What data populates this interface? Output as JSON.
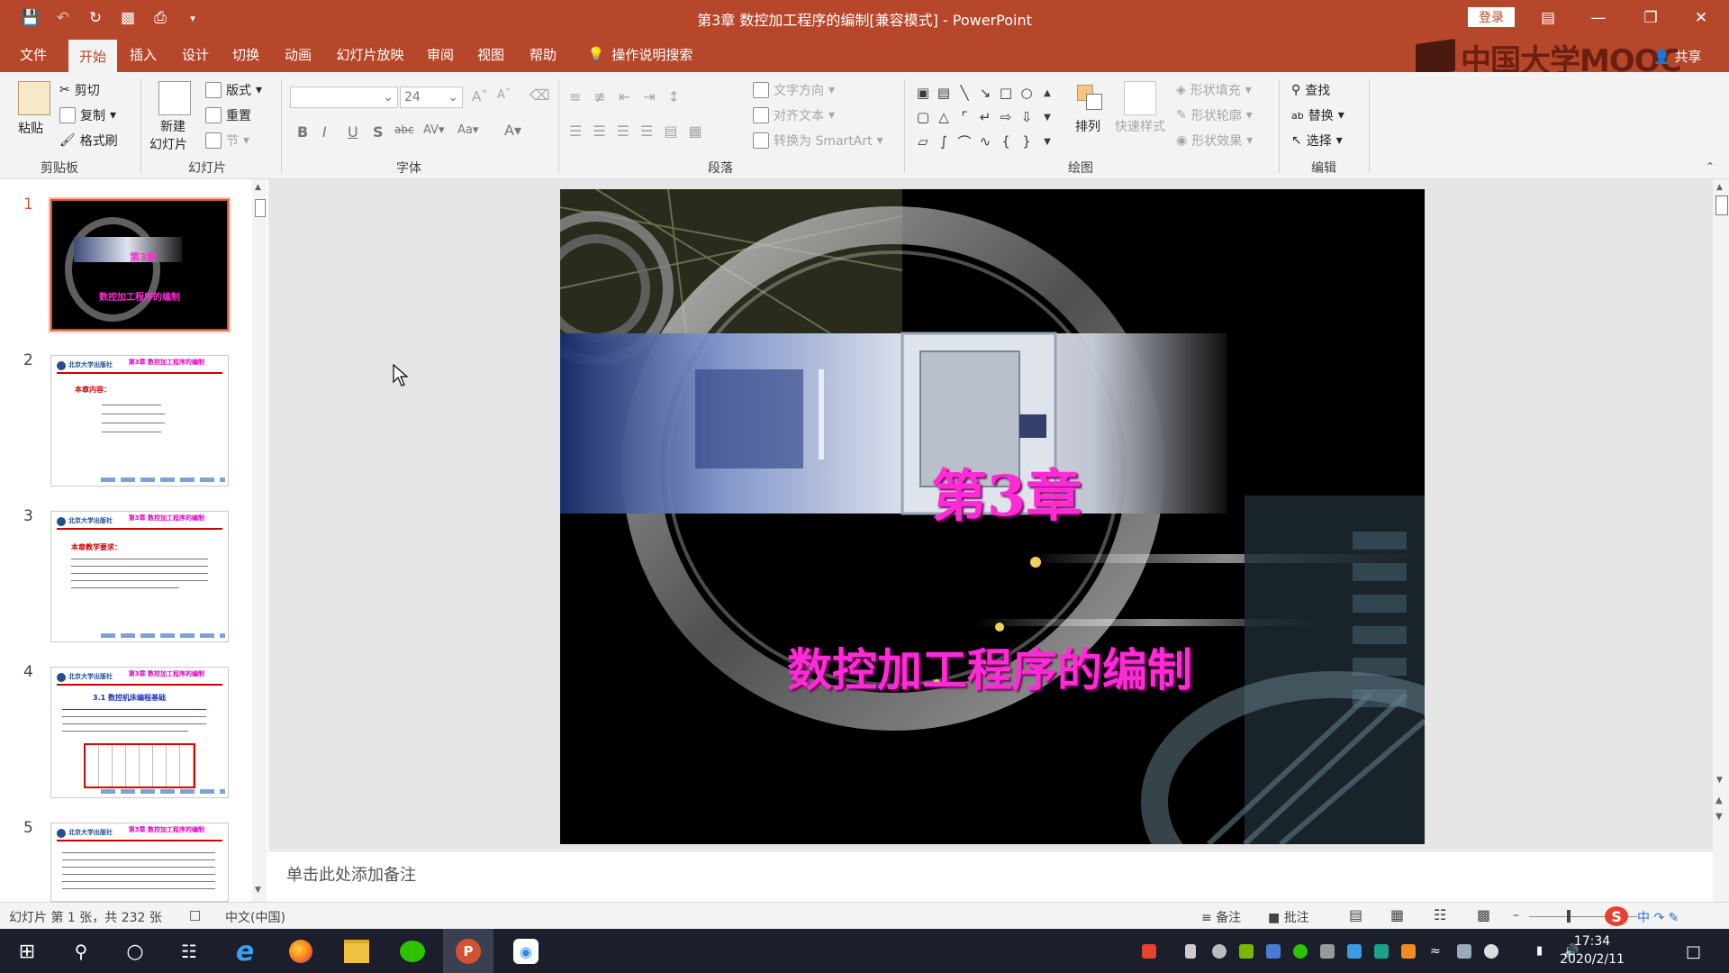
{
  "window": {
    "title": "第3章 数控加工程序的编制[兼容模式] - PowerPoint",
    "login_label": "登录",
    "share_label": "共享",
    "logo_text": "中国大学MOOC"
  },
  "menu_tabs": [
    "文件",
    "开始",
    "插入",
    "设计",
    "切换",
    "动画",
    "幻灯片放映",
    "审阅",
    "视图",
    "帮助"
  ],
  "active_tab": "开始",
  "search_hint": "操作说明搜索",
  "ribbon": {
    "clipboard": {
      "label": "剪贴板",
      "paste": "粘贴",
      "cut": "剪切",
      "copy": "复制",
      "format_painter": "格式刷"
    },
    "slides": {
      "label": "幻灯片",
      "new_slide": "新建",
      "new_slide_2": "幻灯片",
      "layout": "版式",
      "reset": "重置",
      "section": "节"
    },
    "font": {
      "label": "字体",
      "font_name": "",
      "font_size": "24"
    },
    "paragraph": {
      "label": "段落",
      "text_direction": "文字方向",
      "align_text": "对齐文本",
      "smartart": "转换为 SmartArt"
    },
    "drawing": {
      "label": "绘图",
      "arrange": "排列",
      "quick_styles": "快速样式",
      "shape_fill": "形状填充",
      "shape_outline": "形状轮廓",
      "shape_effects": "形状效果"
    },
    "editing": {
      "label": "编辑",
      "find": "查找",
      "replace": "替换",
      "select": "选择"
    }
  },
  "thumbnails": [
    {
      "num": "1",
      "title": "第3章",
      "subtitle": "数控加工程序的编制"
    },
    {
      "num": "2",
      "header_right": "第3章 数控加工程序的编制",
      "heading": "本章内容："
    },
    {
      "num": "3",
      "header_right": "第3章 数控加工程序的编制",
      "heading": "本章教学要求："
    },
    {
      "num": "4",
      "header_right": "第3章 数控加工程序的编制",
      "heading": "3.1 数控机床编程基础"
    },
    {
      "num": "5",
      "header_right": "第3章 数控加工程序的编制"
    }
  ],
  "slide": {
    "chapter": "第3章",
    "title": "数控加工程序的编制",
    "accent_color": "#ff2bd6"
  },
  "notes_placeholder": "单击此处添加备注",
  "status": {
    "slide_info": "幻灯片 第 1 张，共 232 张",
    "language": "中文(中国)",
    "notes": "备注",
    "comments": "批注"
  },
  "taskbar": {
    "time": "17:34",
    "date": "2020/2/11"
  }
}
